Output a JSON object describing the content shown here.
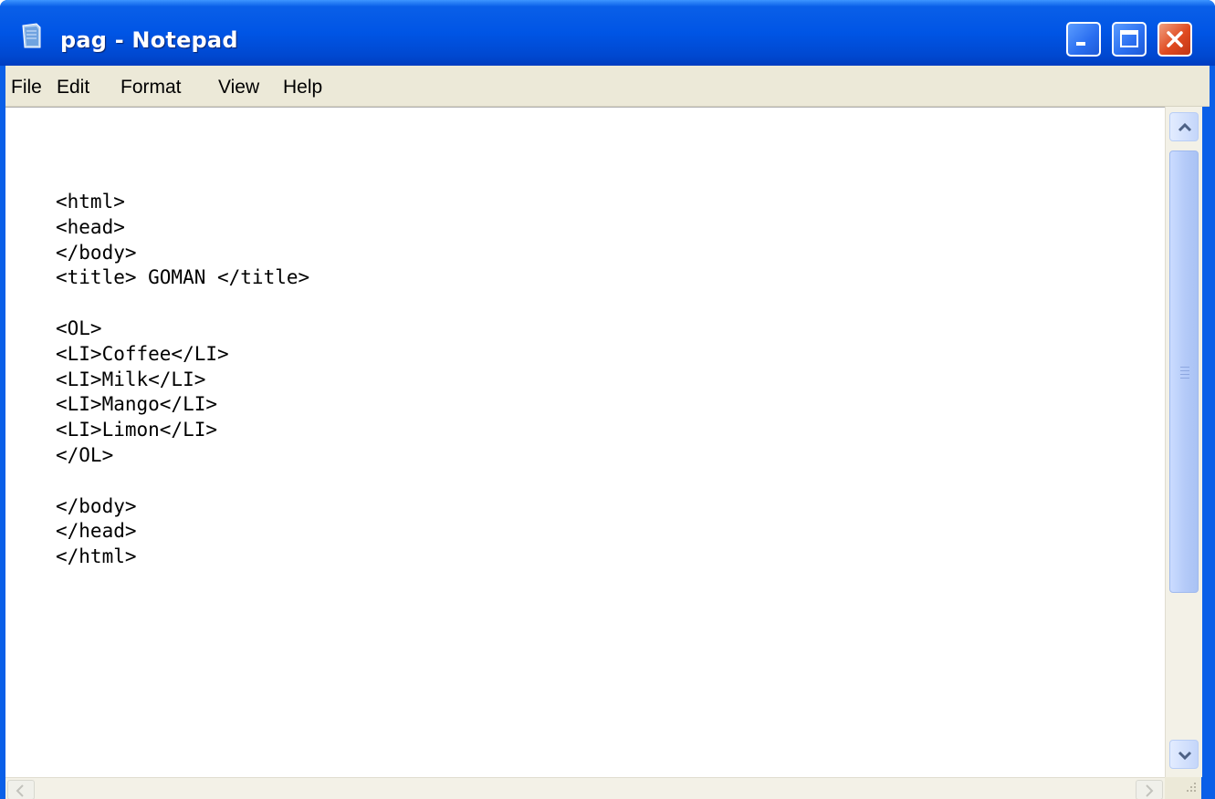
{
  "window": {
    "title": "pag - Notepad",
    "icon": "notepad-icon",
    "controls": [
      "minimize-icon",
      "maximize-icon",
      "close-icon"
    ],
    "title_bar_color": "#0055e5",
    "close_button_color": "#e04a20"
  },
  "menu": {
    "items": [
      "File",
      "Edit",
      "Format",
      "View",
      "Help"
    ]
  },
  "editor": {
    "content": "<html>\n<head>\n</body>\n<title> GOMAN </title>\n\n<OL>\n<LI>Coffee</LI>\n<LI>Milk</LI>\n<LI>Mango</LI>\n<LI>Limon</LI>\n</OL>\n\n</body>\n</head>\n</html>"
  },
  "scrollbars": {
    "vertical_icons": [
      "scroll-up-icon",
      "scroll-down-icon"
    ],
    "horizontal_icons": [
      "scroll-left-icon",
      "scroll-right-icon"
    ]
  }
}
